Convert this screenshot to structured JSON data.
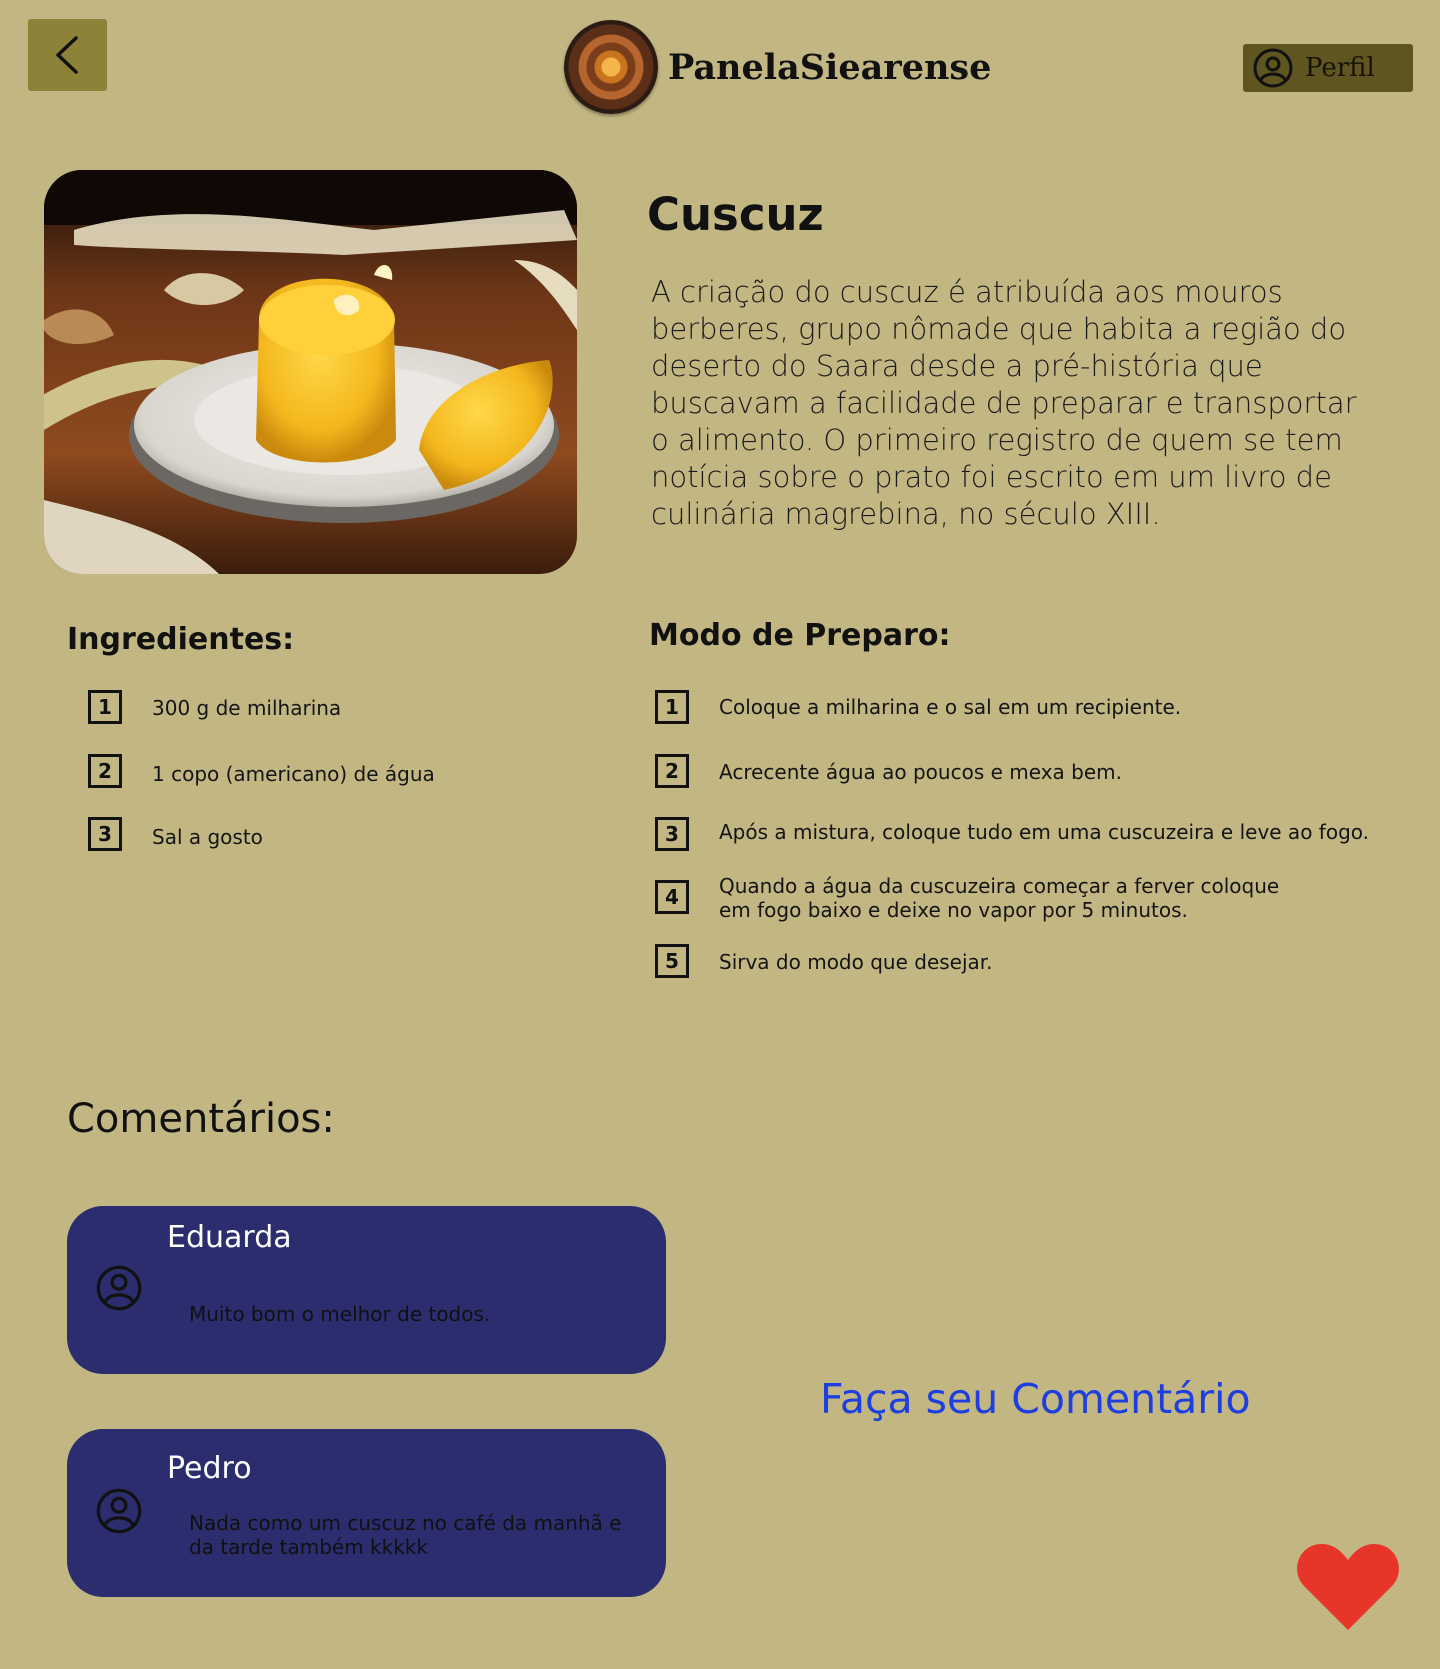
{
  "header": {
    "back_icon": "chevron-left-icon",
    "brand_name": "PanelaSiearense",
    "profile_label": "Perfil",
    "profile_icon": "user-circle-icon"
  },
  "recipe": {
    "title": "Cuscuz",
    "description": "A criação do cuscuz é atribuída aos mouros berberes, grupo nômade que habita a região do deserto do Saara desde a pré-história que buscavam a facilidade de preparar e transportar o alimento. O primeiro registro de quem se tem notícia sobre o prato foi escrito em um livro de culinária magrebina, no século XIII.",
    "ingredients_title": "Ingredientes:",
    "ingredients": [
      {
        "n": "1",
        "text": "300 g de milharina"
      },
      {
        "n": "2",
        "text": "1 copo (americano) de água"
      },
      {
        "n": "3",
        "text": "Sal a gosto"
      }
    ],
    "steps_title": "Modo de Preparo:",
    "steps": [
      {
        "n": "1",
        "text": "Coloque a milharina e o sal em um recipiente."
      },
      {
        "n": "2",
        "text": "Acrecente água ao poucos e mexa bem."
      },
      {
        "n": "3",
        "text": "Após a mistura, coloque tudo em uma cuscuzeira e leve ao fogo."
      },
      {
        "n": "4",
        "text": "Quando a água da cuscuzeira começar a ferver coloque em fogo baixo e deixe no vapor por 5 minutos."
      },
      {
        "n": "5",
        "text": "Sirva do modo que desejar."
      }
    ]
  },
  "comments": {
    "title": "Comentários:",
    "items": [
      {
        "author": "Eduarda",
        "text": "Muito bom o melhor de todos."
      },
      {
        "author": "Pedro",
        "text": "Nada como um cuscuz no café da manhã e da tarde também kkkkk"
      }
    ],
    "cta": "Faça seu Comentário"
  },
  "colors": {
    "background": "#c2b683",
    "comment_card": "#2c2d6f",
    "link": "#1d3fe0",
    "like": "#e8352a"
  },
  "like_icon": "heart-icon"
}
